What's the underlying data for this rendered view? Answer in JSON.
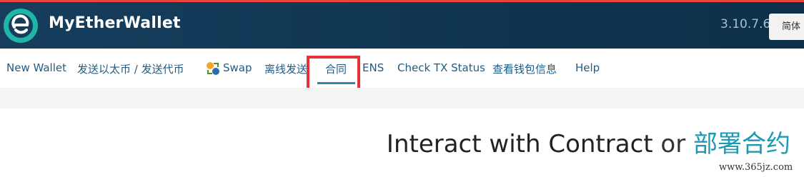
{
  "header": {
    "brand": "MyEtherWallet",
    "version": "3.10.7.6",
    "language_button": "简体"
  },
  "nav": {
    "items": [
      {
        "label": "New Wallet"
      },
      {
        "label": "发送以太币 / 发送代币"
      },
      {
        "label": "Swap",
        "icon": "swap-icon"
      },
      {
        "label": "离线发送"
      },
      {
        "label": "合同",
        "active": true
      },
      {
        "label": "ENS"
      },
      {
        "label": "Check TX Status"
      },
      {
        "label": "查看钱包信息"
      },
      {
        "label": "Help"
      }
    ]
  },
  "main": {
    "heading_part1": "Interact with Contract",
    "heading_or": "or",
    "heading_part2": "部署合约"
  },
  "watermark": "www.365jz.com",
  "colors": {
    "header_bg": "#163e5c",
    "nav_link": "#1f5c85",
    "active_underline": "#2b88b5",
    "highlight_box": "#e53238",
    "deploy_accent": "#1a9bb3",
    "top_strip": "#e8463d"
  }
}
